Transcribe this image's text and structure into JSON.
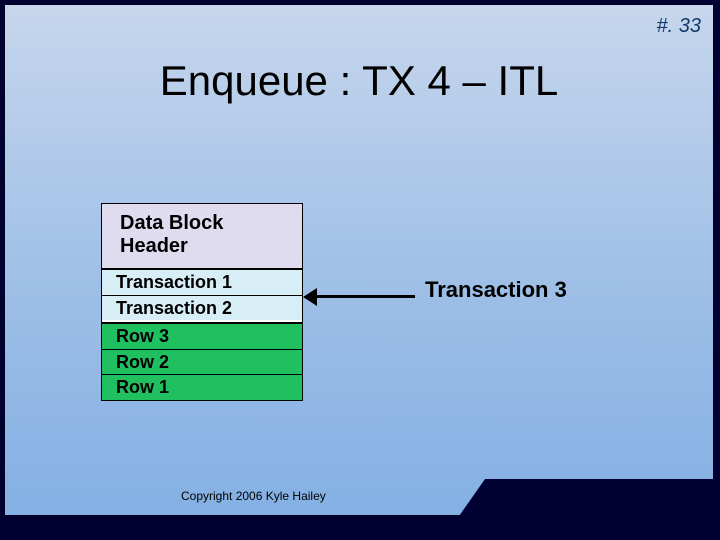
{
  "page_number": "#. 33",
  "title": "Enqueue : TX 4 – ITL",
  "block": {
    "header_line1": "Data Block",
    "header_line2": "Header",
    "itl": [
      "Transaction 1",
      "Transaction 2"
    ],
    "rows": [
      "Row 3",
      "Row 2",
      "Row 1"
    ]
  },
  "pending_tx": "Transaction 3",
  "copyright": "Copyright 2006 Kyle Hailey"
}
